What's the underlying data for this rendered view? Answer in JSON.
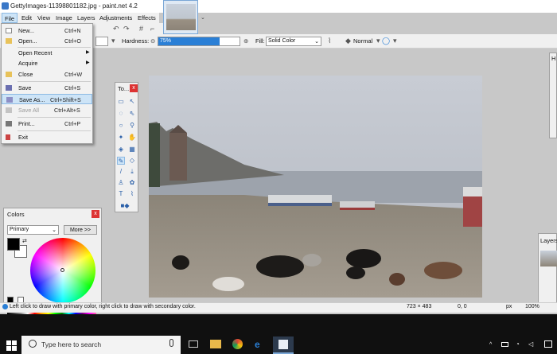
{
  "window": {
    "title": "GettyImages-11398801182.jpg - paint.net 4.2"
  },
  "menu": [
    "File",
    "Edit",
    "View",
    "Image",
    "Layers",
    "Adjustments",
    "Effects"
  ],
  "file_menu": [
    {
      "label": "New...",
      "shortcut": "Ctrl+N",
      "enabled": true
    },
    {
      "label": "Open...",
      "shortcut": "Ctrl+O",
      "enabled": true
    },
    {
      "label": "Open Recent",
      "shortcut": "",
      "submenu": true,
      "enabled": true
    },
    {
      "label": "Acquire",
      "shortcut": "",
      "submenu": true,
      "enabled": true
    },
    {
      "label": "Close",
      "shortcut": "Ctrl+W",
      "enabled": true
    },
    {
      "label": "Save",
      "shortcut": "Ctrl+S",
      "enabled": true
    },
    {
      "label": "Save As...",
      "shortcut": "Ctrl+Shift+S",
      "enabled": true,
      "highlighted": true
    },
    {
      "label": "Save All",
      "shortcut": "Ctrl+Alt+S",
      "enabled": false
    },
    {
      "label": "Print...",
      "shortcut": "Ctrl+P",
      "enabled": true
    },
    {
      "label": "Exit",
      "shortcut": "",
      "enabled": true
    }
  ],
  "toolbar": {
    "hardness_label": "Hardness:",
    "hardness_value": "75%",
    "hardness_fraction": 0.75,
    "fill_label": "Fill:",
    "fill_value": "Solid Color",
    "blend_mode": "Normal"
  },
  "tools_panel": {
    "title": "To..."
  },
  "colors_panel": {
    "title": "Colors",
    "mode": "Primary",
    "more_button": "More >>",
    "primary_color": "#000000",
    "secondary_color": "#ffffff"
  },
  "history_panel": {
    "title": "H"
  },
  "layers_panel": {
    "title": "Layers"
  },
  "status": {
    "hint": "Left click to draw with primary color, right click to draw with secondary color.",
    "image_size": "723 × 483",
    "cursor": "0, 0",
    "units": "px",
    "zoom": "100%"
  },
  "taskbar": {
    "search_placeholder": "Type here to search"
  }
}
